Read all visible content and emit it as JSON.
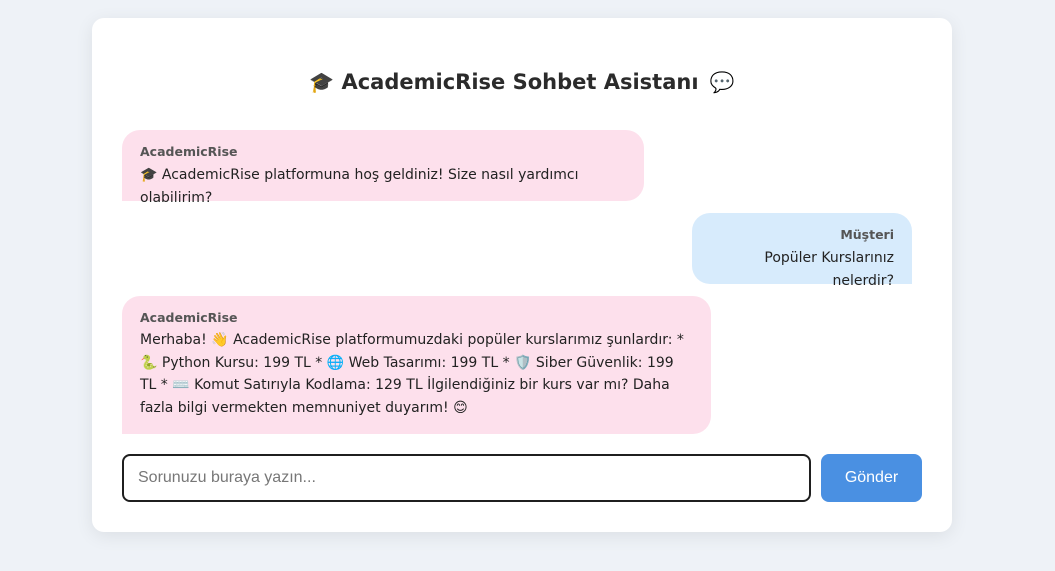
{
  "header": {
    "cap_emoji": "🎓",
    "title": "AcademicRise Sohbet Asistanı",
    "bubble_emoji": "💬"
  },
  "messages": [
    {
      "role": "bot",
      "sender": "AcademicRise",
      "text": "🎓 AcademicRise platformuna hoş geldiniz! Size nasıl yardımcı olabilirim?"
    },
    {
      "role": "user",
      "sender": "Müşteri",
      "text": "Popüler Kurslarınız nelerdir?"
    },
    {
      "role": "bot",
      "sender": "AcademicRise",
      "text": "Merhaba! 👋 AcademicRise platformumuzdaki popüler kurslarımız şunlardır: * 🐍 Python Kursu: 199 TL * 🌐 Web Tasarımı: 199 TL * 🛡️ Siber Güvenlik: 199 TL * ⌨️ Komut Satırıyla Kodlama: 129 TL İlgilendiğiniz bir kurs var mı? Daha fazla bilgi vermekten memnuniyet duyarım! 😊"
    }
  ],
  "composer": {
    "placeholder": "Sorunuzu buraya yazın...",
    "value": "",
    "send_label": "Gönder"
  },
  "colors": {
    "bot_bubble": "#fde0ec",
    "user_bubble": "#d7ebfc",
    "send_button": "#4a90e2",
    "page_background": "#eef2f7"
  }
}
